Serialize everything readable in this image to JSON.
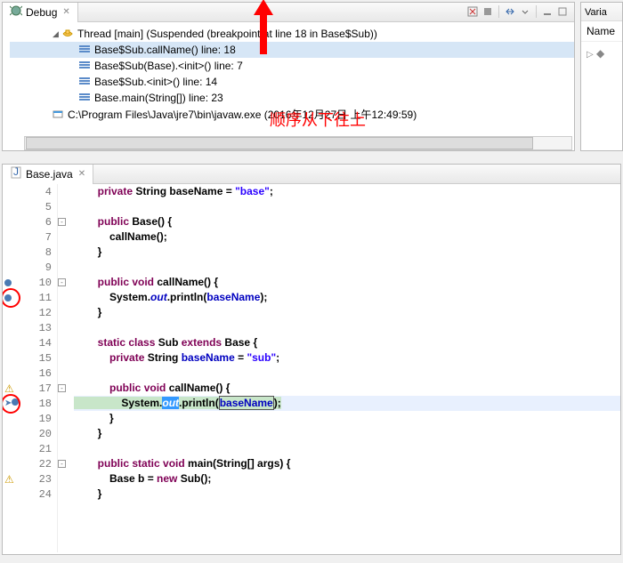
{
  "debug": {
    "tabLabel": "Debug",
    "thread": "Thread [main] (Suspended (breakpoint at line 18 in Base$Sub))",
    "frames": [
      "Base$Sub.callName() line: 18",
      "Base$Sub(Base).<init>() line: 7",
      "Base$Sub.<init>() line: 14",
      "Base.main(String[]) line: 23"
    ],
    "process": "C:\\Program Files\\Java\\jre7\\bin\\javaw.exe (2016年12月27日 上午12:49:59)"
  },
  "vars": {
    "tabLabel": "Varia",
    "col": "Name"
  },
  "annotation": "顺序从下往上",
  "editor": {
    "tabLabel": "Base.java",
    "lines": [
      {
        "n": 4,
        "ind": 2,
        "tokens": [
          {
            "t": "private ",
            "c": "kw"
          },
          {
            "t": "String baseName = "
          },
          {
            "t": "\"base\"",
            "c": "str"
          },
          {
            "t": ";"
          }
        ]
      },
      {
        "n": 5,
        "ind": 0,
        "tokens": []
      },
      {
        "n": 6,
        "ind": 2,
        "fold": "-",
        "tokens": [
          {
            "t": "public ",
            "c": "kw"
          },
          {
            "t": "Base() {"
          }
        ]
      },
      {
        "n": 7,
        "ind": 3,
        "tokens": [
          {
            "t": "callName();"
          }
        ]
      },
      {
        "n": 8,
        "ind": 2,
        "tokens": [
          {
            "t": "}"
          }
        ]
      },
      {
        "n": 9,
        "ind": 0,
        "tokens": []
      },
      {
        "n": 10,
        "ind": 2,
        "fold": "-",
        "anno": "bp",
        "tokens": [
          {
            "t": "public ",
            "c": "kw"
          },
          {
            "t": "void ",
            "c": "kw"
          },
          {
            "t": "callName() {"
          }
        ]
      },
      {
        "n": 11,
        "ind": 3,
        "anno": "bp",
        "circle": true,
        "tokens": [
          {
            "t": "System."
          },
          {
            "t": "out",
            "c": "sta"
          },
          {
            "t": ".println("
          },
          {
            "t": "baseName",
            "c": "fld"
          },
          {
            "t": ");"
          }
        ]
      },
      {
        "n": 12,
        "ind": 2,
        "tokens": [
          {
            "t": "}"
          }
        ]
      },
      {
        "n": 13,
        "ind": 0,
        "tokens": []
      },
      {
        "n": 14,
        "ind": 2,
        "tokens": [
          {
            "t": "static ",
            "c": "kw"
          },
          {
            "t": "class ",
            "c": "kw"
          },
          {
            "t": "Sub "
          },
          {
            "t": "extends ",
            "c": "kw"
          },
          {
            "t": "Base {"
          }
        ]
      },
      {
        "n": 15,
        "ind": 3,
        "tokens": [
          {
            "t": "private ",
            "c": "kw"
          },
          {
            "t": "String "
          },
          {
            "t": "baseName",
            "c": "fld"
          },
          {
            "t": " = "
          },
          {
            "t": "\"sub\"",
            "c": "str"
          },
          {
            "t": ";"
          }
        ]
      },
      {
        "n": 16,
        "ind": 0,
        "tokens": []
      },
      {
        "n": 17,
        "ind": 3,
        "fold": "-",
        "anno": "warn",
        "tokens": [
          {
            "t": "public ",
            "c": "kw"
          },
          {
            "t": "void ",
            "c": "kw"
          },
          {
            "t": "callName() {"
          }
        ]
      },
      {
        "n": 18,
        "ind": 4,
        "anno": "cur",
        "circle": true,
        "hl": "green",
        "tokens": [
          {
            "t": "System."
          },
          {
            "t": "out",
            "c": "sta sel"
          },
          {
            "t": ".println("
          },
          {
            "t": "baseName",
            "c": "fld box"
          },
          {
            "t": ");"
          }
        ]
      },
      {
        "n": 19,
        "ind": 3,
        "tokens": [
          {
            "t": "}"
          }
        ]
      },
      {
        "n": 20,
        "ind": 2,
        "tokens": [
          {
            "t": "}"
          }
        ]
      },
      {
        "n": 21,
        "ind": 0,
        "tokens": []
      },
      {
        "n": 22,
        "ind": 2,
        "fold": "-",
        "tokens": [
          {
            "t": "public ",
            "c": "kw"
          },
          {
            "t": "static ",
            "c": "kw"
          },
          {
            "t": "void ",
            "c": "kw"
          },
          {
            "t": "main(String[] args) {"
          }
        ]
      },
      {
        "n": 23,
        "ind": 3,
        "anno": "warn",
        "tokens": [
          {
            "t": "Base b = "
          },
          {
            "t": "new ",
            "c": "kw"
          },
          {
            "t": "Sub();"
          }
        ]
      },
      {
        "n": 24,
        "ind": 2,
        "tokens": [
          {
            "t": "}"
          }
        ]
      }
    ]
  }
}
